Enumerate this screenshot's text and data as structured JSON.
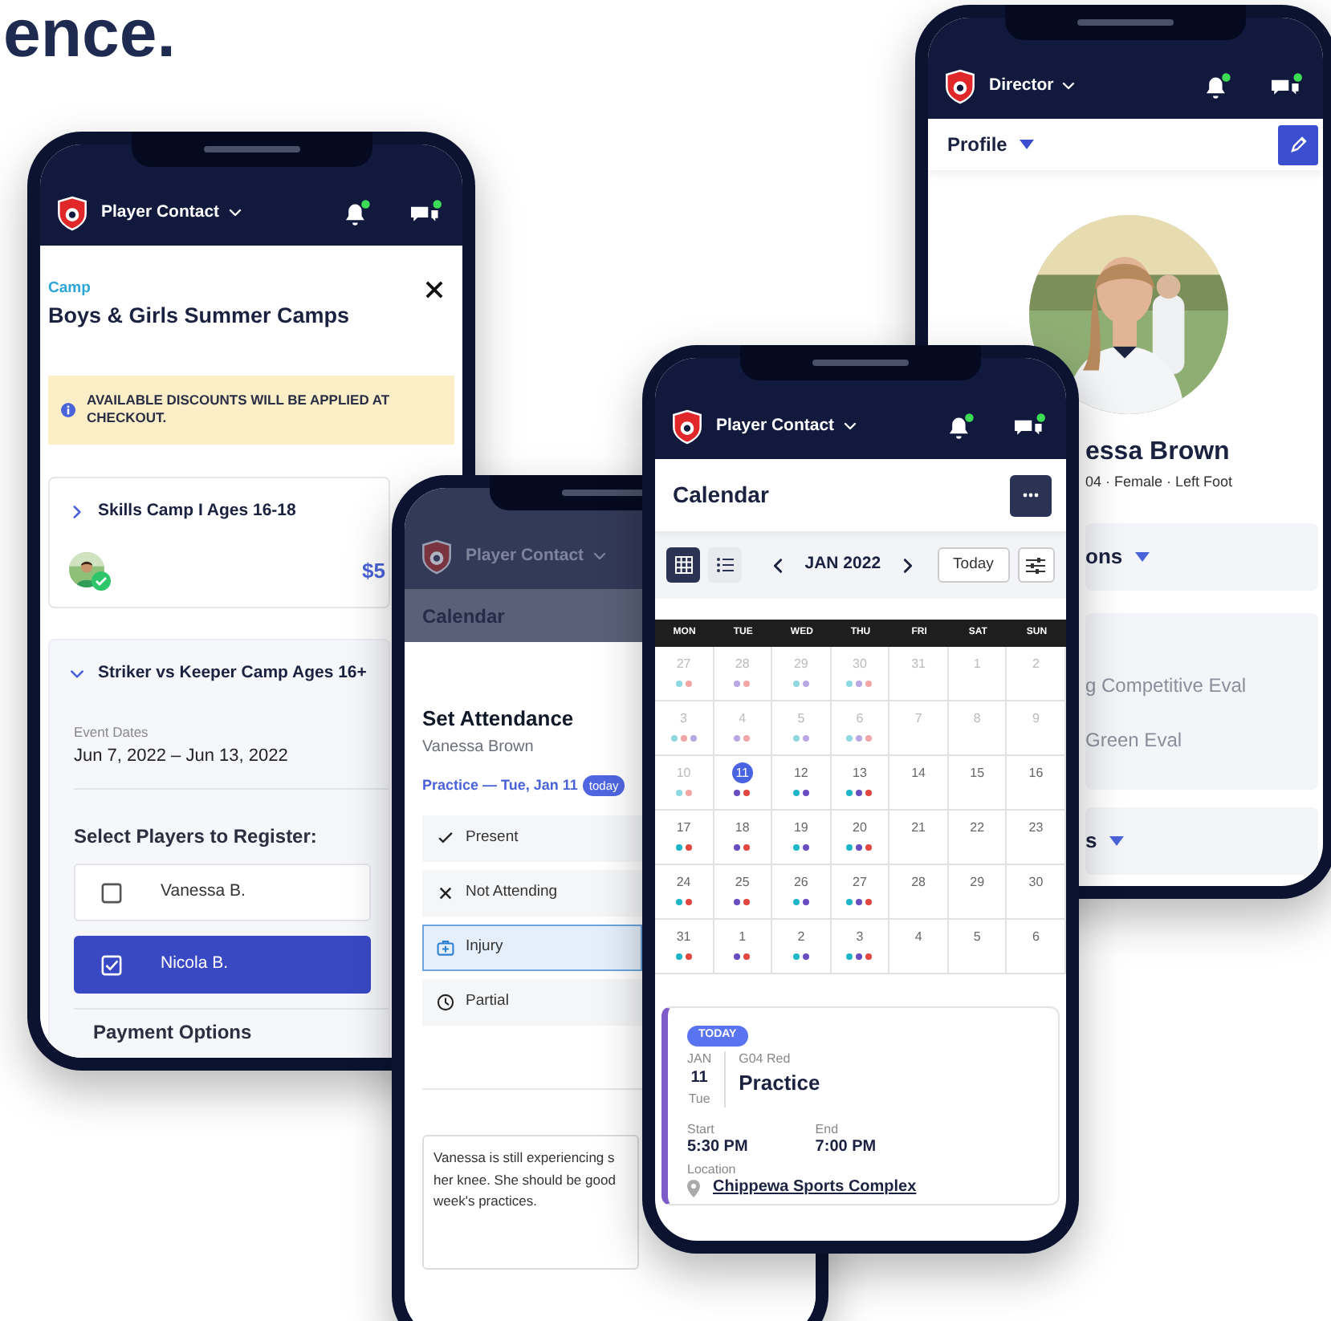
{
  "headline": "ence.",
  "registration_phone": {
    "header": {
      "title": "Player Contact",
      "dimmed": false
    },
    "eyebrow": "Camp",
    "title": "Boys & Girls Summer Camps",
    "notice": "AVAILABLE DISCOUNTS WILL BE APPLIED AT CHECKOUT.",
    "camps": [
      {
        "name": "Skills Camp I Ages 16-18",
        "expanded": false,
        "price": "$5"
      },
      {
        "name": "Striker vs Keeper Camp Ages 16+",
        "expanded": true,
        "dates_label": "Event Dates",
        "dates": "Jun 7, 2022 – Jun 13, 2022",
        "players_heading": "Select Players to Register:",
        "players": [
          {
            "name": "Vanessa B.",
            "selected": false
          },
          {
            "name": "Nicola B.",
            "selected": true
          }
        ]
      }
    ],
    "payment_heading": "Payment Options"
  },
  "profile_phone": {
    "header": {
      "title": "Director",
      "dimmed": false
    },
    "page_title": "Profile",
    "name": "essa Brown",
    "details": "04 · Female · Left Foot",
    "section_headings": [
      "ons",
      "s"
    ],
    "evaluations": [
      "g Competitive Eval",
      "Green Eval"
    ]
  },
  "attendance_phone": {
    "header": {
      "title": "Player Contact",
      "dimmed": true
    },
    "page_title": "Calendar",
    "sheet_title": "Set Attendance",
    "player": "Vanessa Brown",
    "event": "Practice — Tue, Jan 11",
    "event_badge": "today",
    "options": [
      {
        "label": "Present",
        "kind": "check",
        "selected": false
      },
      {
        "label": "Not Attending",
        "kind": "cross",
        "selected": false
      },
      {
        "label": "Injury",
        "kind": "medkit",
        "selected": true
      },
      {
        "label": "Partial",
        "kind": "clock",
        "selected": false
      }
    ],
    "note_lines": [
      "Vanessa is still experiencing s",
      "her knee. She should be good",
      "week's practices."
    ]
  },
  "calendar_phone": {
    "header": {
      "title": "Player Contact",
      "dimmed": false
    },
    "page_title": "Calendar",
    "views": [
      {
        "kind": "grid",
        "selected": true
      },
      {
        "kind": "list",
        "selected": false
      }
    ],
    "month": "JAN 2022",
    "today_button": "Today",
    "weekdays": [
      "MON",
      "TUE",
      "WED",
      "THU",
      "FRI",
      "SAT",
      "SUN"
    ],
    "weeks": [
      [
        {
          "day": "27",
          "muted": true,
          "selected": false,
          "dots": [
            {
              "color": "#8fd8e2"
            },
            {
              "color": "#f2a5a5"
            }
          ]
        },
        {
          "day": "28",
          "muted": true,
          "selected": false,
          "dots": [
            {
              "color": "#b9a8e3"
            },
            {
              "color": "#f2a5a5"
            }
          ]
        },
        {
          "day": "29",
          "muted": true,
          "selected": false,
          "dots": [
            {
              "color": "#8fd8e2"
            },
            {
              "color": "#b9a8e3"
            }
          ]
        },
        {
          "day": "30",
          "muted": true,
          "selected": false,
          "dots": [
            {
              "color": "#8fd8e2"
            },
            {
              "color": "#b9a8e3"
            },
            {
              "color": "#f2a5a5"
            }
          ]
        },
        {
          "day": "31",
          "muted": true,
          "selected": false
        },
        {
          "day": "1",
          "muted": true,
          "selected": false
        },
        {
          "day": "2",
          "muted": true,
          "selected": false
        }
      ],
      [
        {
          "day": "3",
          "muted": true,
          "selected": false,
          "dots": [
            {
              "color": "#8fd8e2"
            },
            {
              "color": "#f2a5a5"
            },
            {
              "color": "#b9a8e3"
            }
          ]
        },
        {
          "day": "4",
          "muted": true,
          "selected": false,
          "dots": [
            {
              "color": "#b9a8e3"
            },
            {
              "color": "#f2a5a5"
            }
          ]
        },
        {
          "day": "5",
          "muted": true,
          "selected": false,
          "dots": [
            {
              "color": "#8fd8e2"
            },
            {
              "color": "#b9a8e3"
            }
          ]
        },
        {
          "day": "6",
          "muted": true,
          "selected": false,
          "dots": [
            {
              "color": "#8fd8e2"
            },
            {
              "color": "#b9a8e3"
            },
            {
              "color": "#f2a5a5"
            }
          ]
        },
        {
          "day": "7",
          "muted": true,
          "selected": false
        },
        {
          "day": "8",
          "muted": true,
          "selected": false
        },
        {
          "day": "9",
          "muted": true,
          "selected": false
        }
      ],
      [
        {
          "day": "10",
          "muted": true,
          "selected": false,
          "dots": [
            {
              "color": "#8fd8e2"
            },
            {
              "color": "#f2a5a5"
            }
          ]
        },
        {
          "day": "11",
          "muted": false,
          "selected": true,
          "dots": [
            {
              "color": "#6a4cc0"
            },
            {
              "color": "#e2463f"
            }
          ]
        },
        {
          "day": "12",
          "muted": false,
          "selected": false,
          "dots": [
            {
              "color": "#1fb5c8"
            },
            {
              "color": "#6a4cc0"
            }
          ]
        },
        {
          "day": "13",
          "muted": false,
          "selected": false,
          "dots": [
            {
              "color": "#1fb5c8"
            },
            {
              "color": "#6a4cc0"
            },
            {
              "color": "#e2463f"
            }
          ]
        },
        {
          "day": "14",
          "muted": false,
          "selected": false
        },
        {
          "day": "15",
          "muted": false,
          "selected": false
        },
        {
          "day": "16",
          "muted": false,
          "selected": false
        }
      ],
      [
        {
          "day": "17",
          "muted": false,
          "selected": false,
          "dots": [
            {
              "color": "#1fb5c8"
            },
            {
              "color": "#e2463f"
            }
          ]
        },
        {
          "day": "18",
          "muted": false,
          "selected": false,
          "dots": [
            {
              "color": "#6a4cc0"
            },
            {
              "color": "#e2463f"
            }
          ]
        },
        {
          "day": "19",
          "muted": false,
          "selected": false,
          "dots": [
            {
              "color": "#1fb5c8"
            },
            {
              "color": "#6a4cc0"
            }
          ]
        },
        {
          "day": "20",
          "muted": false,
          "selected": false,
          "dots": [
            {
              "color": "#1fb5c8"
            },
            {
              "color": "#6a4cc0"
            },
            {
              "color": "#e2463f"
            }
          ]
        },
        {
          "day": "21",
          "muted": false,
          "selected": false
        },
        {
          "day": "22",
          "muted": false,
          "selected": false
        },
        {
          "day": "23",
          "muted": false,
          "selected": false
        }
      ],
      [
        {
          "day": "24",
          "muted": false,
          "selected": false,
          "dots": [
            {
              "color": "#1fb5c8"
            },
            {
              "color": "#e2463f"
            }
          ]
        },
        {
          "day": "25",
          "muted": false,
          "selected": false,
          "dots": [
            {
              "color": "#6a4cc0"
            },
            {
              "color": "#e2463f"
            }
          ]
        },
        {
          "day": "26",
          "muted": false,
          "selected": false,
          "dots": [
            {
              "color": "#1fb5c8"
            },
            {
              "color": "#6a4cc0"
            }
          ]
        },
        {
          "day": "27",
          "muted": false,
          "selected": false,
          "dots": [
            {
              "color": "#1fb5c8"
            },
            {
              "color": "#6a4cc0"
            },
            {
              "color": "#e2463f"
            }
          ]
        },
        {
          "day": "28",
          "muted": false,
          "selected": false
        },
        {
          "day": "29",
          "muted": false,
          "selected": false
        },
        {
          "day": "30",
          "muted": false,
          "selected": false
        }
      ],
      [
        {
          "day": "31",
          "muted": false,
          "selected": false,
          "dots": [
            {
              "color": "#1fb5c8"
            },
            {
              "color": "#e2463f"
            }
          ]
        },
        {
          "day": "1",
          "muted": false,
          "selected": false,
          "dots": [
            {
              "color": "#6a4cc0"
            },
            {
              "color": "#e2463f"
            }
          ]
        },
        {
          "day": "2",
          "muted": false,
          "selected": false,
          "dots": [
            {
              "color": "#1fb5c8"
            },
            {
              "color": "#6a4cc0"
            }
          ]
        },
        {
          "day": "3",
          "muted": false,
          "selected": false,
          "dots": [
            {
              "color": "#1fb5c8"
            },
            {
              "color": "#6a4cc0"
            },
            {
              "color": "#e2463f"
            }
          ]
        },
        {
          "day": "4",
          "muted": false,
          "selected": false
        },
        {
          "day": "5",
          "muted": false,
          "selected": false
        },
        {
          "day": "6",
          "muted": false,
          "selected": false
        }
      ]
    ],
    "event": {
      "badge": "TODAY",
      "month": "JAN",
      "day": "11",
      "weekday": "Tue",
      "team": "G04 Red",
      "title": "Practice",
      "start_label": "Start",
      "start": "5:30 PM",
      "end_label": "End",
      "end": "7:00 PM",
      "location_label": "Location",
      "location": "Chippewa Sports Complex"
    }
  }
}
